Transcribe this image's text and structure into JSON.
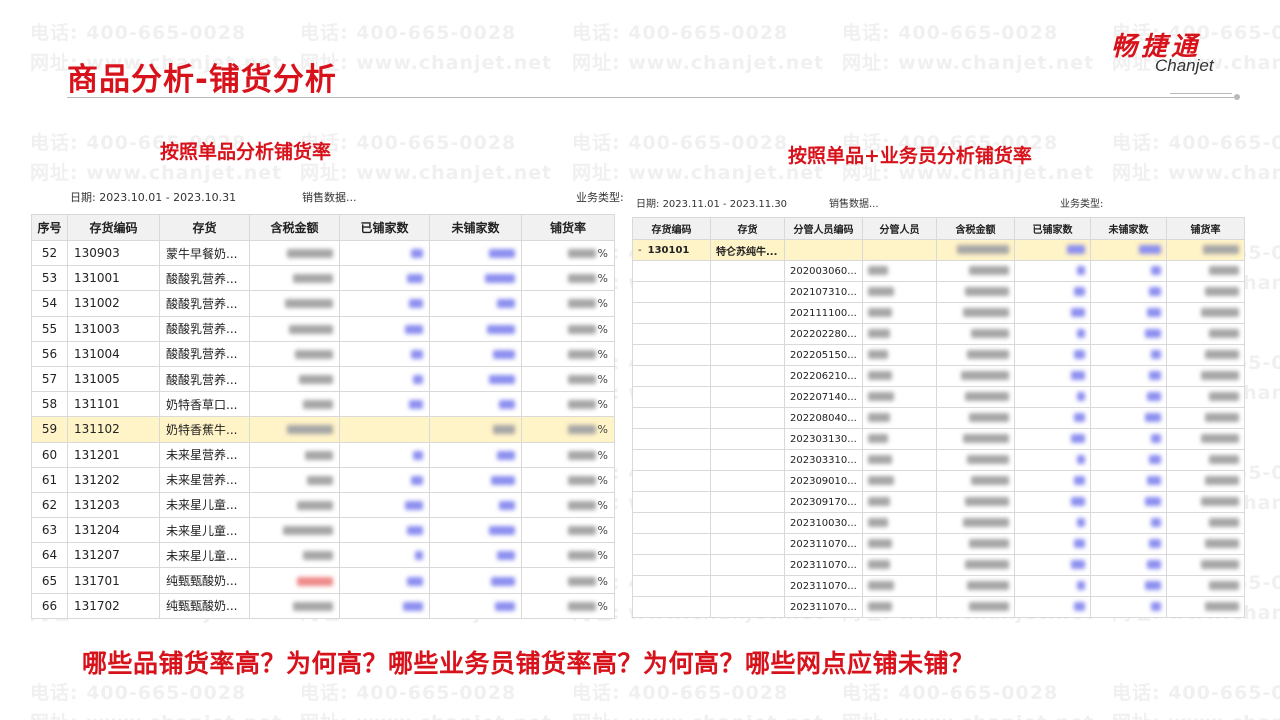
{
  "header": {
    "title": "商品分析-铺货分析",
    "logo_cn": "畅捷通",
    "logo_en": "Chanjet"
  },
  "watermark": {
    "phone": "电话: 400-665-0028",
    "site": "网址: www.chanjet.net"
  },
  "left_panel": {
    "subtitle": "按照单品分析铺货率",
    "date_label": "日期:",
    "date_value": "2023.10.01 - 2023.10.31",
    "sales_label": "销售数据...",
    "columns": [
      "序号",
      "存货编码",
      "存货",
      "含税金额",
      "已铺家数",
      "未铺家数",
      "铺货率"
    ],
    "percent_sign": "%",
    "rows": [
      {
        "no": "52",
        "code": "130903",
        "name": "蒙牛早餐奶..."
      },
      {
        "no": "53",
        "code": "131001",
        "name": "酸酸乳营养..."
      },
      {
        "no": "54",
        "code": "131002",
        "name": "酸酸乳营养..."
      },
      {
        "no": "55",
        "code": "131003",
        "name": "酸酸乳营养..."
      },
      {
        "no": "56",
        "code": "131004",
        "name": "酸酸乳营养..."
      },
      {
        "no": "57",
        "code": "131005",
        "name": "酸酸乳营养..."
      },
      {
        "no": "58",
        "code": "131101",
        "name": "奶特香草口..."
      },
      {
        "no": "59",
        "code": "131102",
        "name": "奶特香蕉牛..."
      },
      {
        "no": "60",
        "code": "131201",
        "name": "未来星营养..."
      },
      {
        "no": "61",
        "code": "131202",
        "name": "未来星营养..."
      },
      {
        "no": "62",
        "code": "131203",
        "name": "未来星儿童..."
      },
      {
        "no": "63",
        "code": "131204",
        "name": "未来星儿童..."
      },
      {
        "no": "64",
        "code": "131207",
        "name": "未来星儿童..."
      },
      {
        "no": "65",
        "code": "131701",
        "name": "纯甄甄酸奶..."
      },
      {
        "no": "66",
        "code": "131702",
        "name": "纯甄甄酸奶..."
      }
    ]
  },
  "right_panel": {
    "subtitle": "按照单品+业务员分析铺货率",
    "date_label": "日期:",
    "date_value": "2023.11.01 - 2023.11.30",
    "sales_label": "销售数据...",
    "columns": [
      "存货编码",
      "存货",
      "分管人员编码",
      "分管人员",
      "含税金额",
      "已铺家数",
      "未铺家数",
      "铺货率"
    ],
    "group_row": {
      "expand_marker": "-",
      "code": "130101",
      "name": "特仑苏纯牛..."
    },
    "staff_codes": [
      "202003060...",
      "202107310...",
      "202111100...",
      "202202280...",
      "202205150...",
      "202206210...",
      "202207140...",
      "202208040...",
      "202303130...",
      "202303310...",
      "202309010...",
      "202309170...",
      "202310030...",
      "202311070...",
      "202311070...",
      "202311070...",
      "202311070..."
    ]
  },
  "business_type_label": "业务类型:",
  "question": "哪些品铺货率高？为何高？哪些业务员铺货率高？为何高？哪些网点应铺未铺？",
  "colors": {
    "brand_red": "#d8121b",
    "highlight_row": "#fff3c8",
    "blur_blue": "#8d8ff0"
  }
}
